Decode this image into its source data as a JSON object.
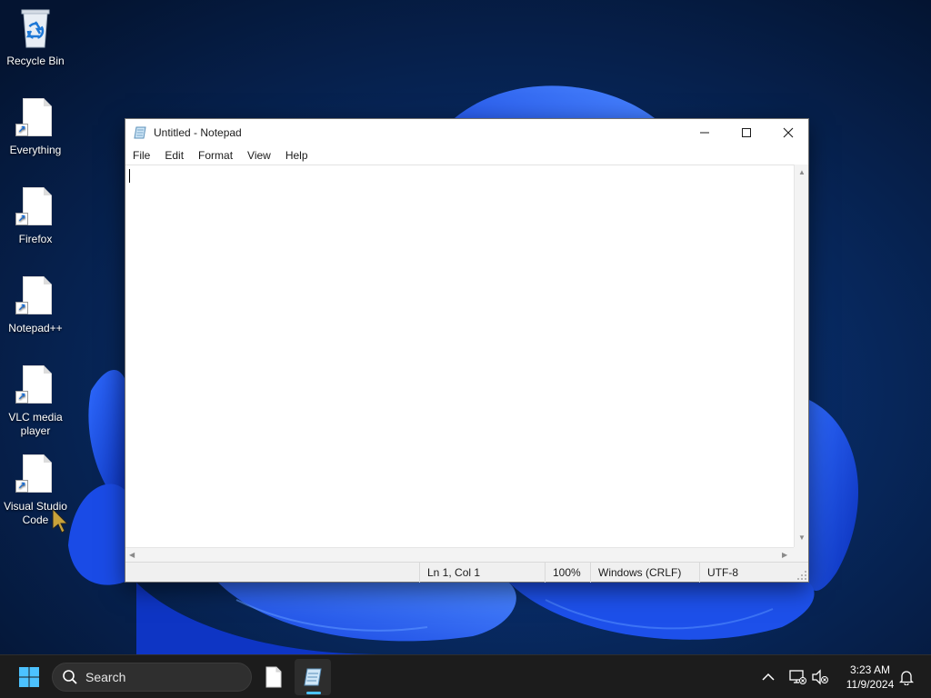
{
  "desktop": {
    "icons": [
      {
        "label": "Recycle Bin",
        "icon": "recycle-bin-icon"
      },
      {
        "label": "Everything",
        "icon": "file-shortcut-icon"
      },
      {
        "label": "Firefox",
        "icon": "file-shortcut-icon"
      },
      {
        "label": "Notepad++",
        "icon": "file-shortcut-icon"
      },
      {
        "label": "VLC media\nplayer",
        "icon": "file-shortcut-icon"
      },
      {
        "label": "Visual Studio\nCode",
        "icon": "file-shortcut-icon"
      }
    ]
  },
  "notepad": {
    "title": "Untitled - Notepad",
    "menu": [
      "File",
      "Edit",
      "Format",
      "View",
      "Help"
    ],
    "content": "",
    "status": {
      "position": "Ln 1, Col 1",
      "zoom": "100%",
      "line_endings": "Windows (CRLF)",
      "encoding": "UTF-8"
    }
  },
  "taskbar": {
    "search_placeholder": "Search",
    "clock_time": "3:23 AM",
    "clock_date": "11/9/2024",
    "accent_color": "#4cc2ff"
  }
}
